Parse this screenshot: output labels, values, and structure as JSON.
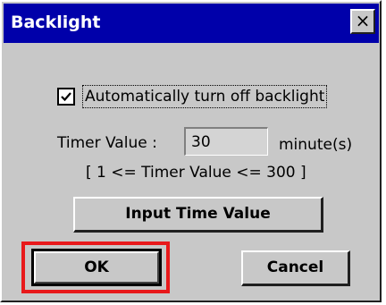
{
  "window": {
    "title": "Backlight",
    "close_glyph": "×"
  },
  "auto_off": {
    "checked": true,
    "label": "Automatically turn off backlight"
  },
  "timer": {
    "label": "Timer Value :",
    "value": "30",
    "unit": "minute(s)",
    "range": "[ 1 <= Timer Value <= 300 ]"
  },
  "buttons": {
    "input_time": "Input Time Value",
    "ok": "OK",
    "cancel": "Cancel"
  },
  "colors": {
    "titlebar": "#0000aa",
    "highlight": "#e8191b",
    "dialog_bg": "#c8c8c8"
  }
}
